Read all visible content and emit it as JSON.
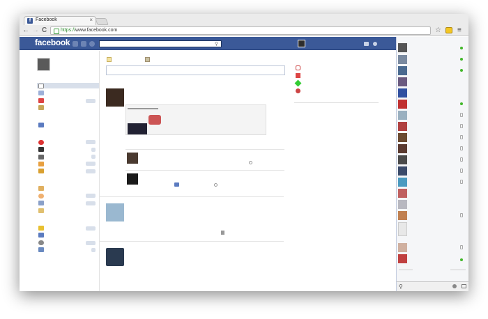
{
  "browser": {
    "tab_title": "Facebook",
    "tab_close": "×",
    "url_scheme": "https://",
    "url_rest": "www.facebook.com",
    "back": "←",
    "forward": "→",
    "reload": "C",
    "star": "☆",
    "menu": "≡"
  },
  "facebook": {
    "logo": "facebook",
    "favicon_letter": "f"
  },
  "colors": {
    "fb_blue": "#3b5998",
    "online_green": "#42b72a"
  },
  "icons": [
    "friend-requests-icon",
    "messages-icon",
    "notifications-icon",
    "search-icon",
    "settings-icon",
    "home-icon"
  ]
}
